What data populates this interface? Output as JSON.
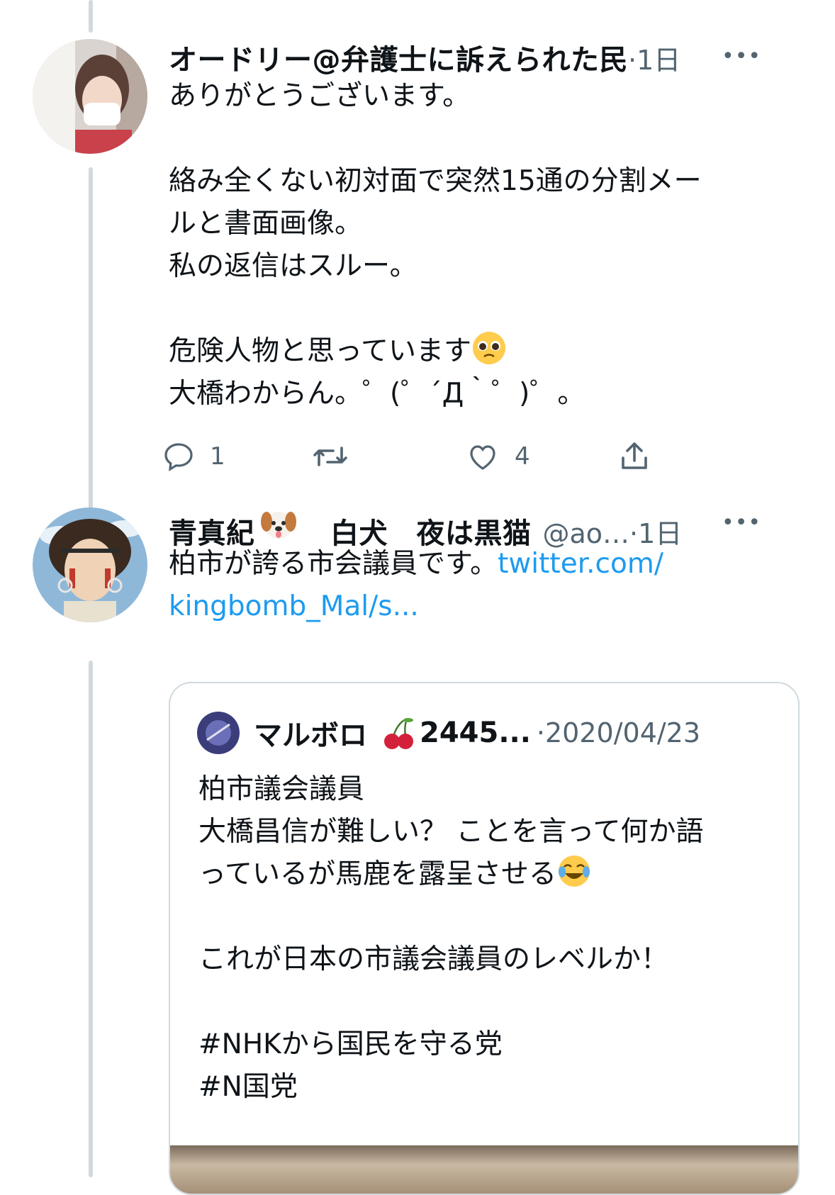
{
  "tweets": [
    {
      "name": "オードリー@弁護士に訴えられた民",
      "meta": "·1日",
      "more": "•••",
      "lines": [
        "ありがとうございます。",
        "",
        "絡み全くない初対面で突然15通の分割メー",
        "ルと書面画像。",
        "私の返信はスルー。",
        "",
        "危険人物と思っています",
        "大橋わからん。゜(゜´Д｀゜)゜。"
      ],
      "actions": {
        "reply_count": "1",
        "retweet_count": "",
        "like_count": "4"
      }
    },
    {
      "name": "青真紀",
      "name_suffix": "　白犬　夜は黒猫",
      "handle": "@ao…",
      "meta": "·1日",
      "more": "•••",
      "text_line1": "柏市が誇る市会議員です。",
      "link_line1": "twitter.com/",
      "link_line2": "kingbomb_Mal/s...",
      "quote": {
        "name": "マルボロ",
        "name_suffix": "2445...",
        "meta": "·2020/04/23",
        "lines": [
          "柏市議会議員",
          "大橋昌信が難しい？ ことを言って何か語",
          "っているが馬鹿を露呈させる",
          "",
          "これが日本の市議会議員のレベルか！",
          "",
          "#NHKから国民を守る党",
          "#N国党"
        ]
      }
    }
  ],
  "icons": {
    "reply": "reply-icon",
    "retweet": "retweet-icon",
    "like": "like-icon",
    "share": "share-icon",
    "dog": "dog-face-emoji",
    "cherry": "cherry-emoji",
    "pleading": "pleading-face-emoji",
    "joy": "face-with-tears-of-joy-emoji"
  },
  "colors": {
    "link": "#1d9bf0",
    "muted": "#536471",
    "border": "#cfd9de"
  }
}
